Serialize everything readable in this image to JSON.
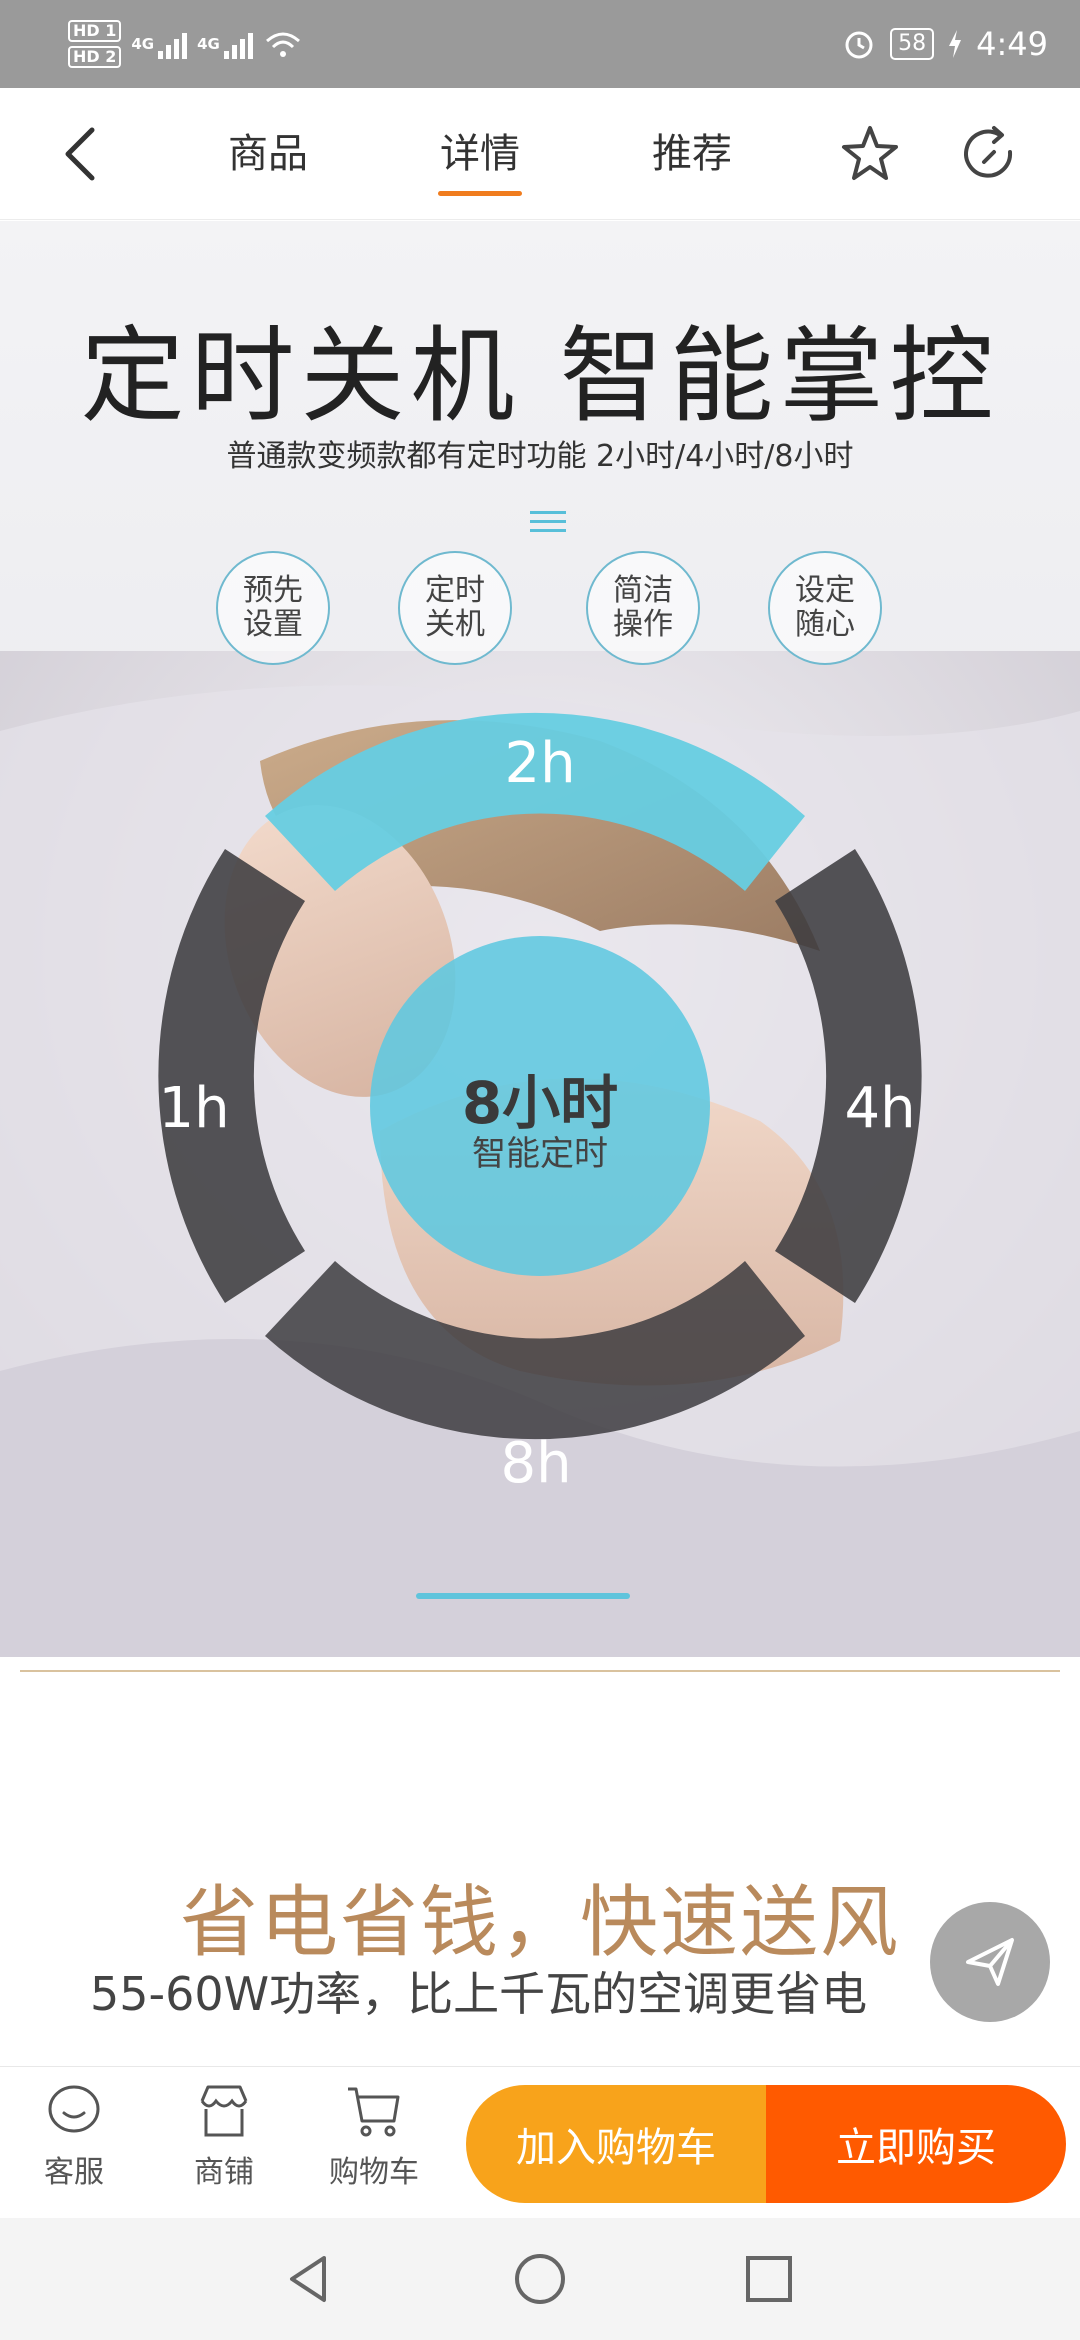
{
  "status_bar": {
    "hd1": "HD 1",
    "hd2": "HD 2",
    "network1": "4G",
    "network2": "4G",
    "battery": "58",
    "time": "4:49",
    "icons": [
      "wifi-icon",
      "alarm-icon",
      "charging-icon"
    ]
  },
  "nav": {
    "tabs": [
      {
        "label": "商品",
        "active": false
      },
      {
        "label": "详情",
        "active": true
      },
      {
        "label": "推荐",
        "active": false
      }
    ],
    "icons": [
      "back-icon",
      "star-icon",
      "refresh-icon"
    ],
    "accent_color": "#f07c1e"
  },
  "banner": {
    "title": "定时关机 智能掌控",
    "subtitle": "普通款变频款都有定时功能 2小时/4小时/8小时",
    "features": [
      {
        "line1": "预先",
        "line2": "设置"
      },
      {
        "line1": "定时",
        "line2": "关机"
      },
      {
        "line1": "简洁",
        "line2": "操作"
      },
      {
        "line1": "设定",
        "line2": "随心"
      }
    ],
    "timer_options": {
      "top": "2h",
      "left": "1h",
      "right": "4h",
      "bottom": "8h"
    },
    "selected": "2h",
    "center_main": "8小时",
    "center_sub": "智能定时",
    "highlight_color": "#66cde2",
    "ring_color": "#3d3c40"
  },
  "promo": {
    "title": "省电省钱，快速送风",
    "subtitle": "55-60W功率，比上千瓦的空调更省电",
    "title_color": "#b98a5c"
  },
  "bottom_bar": {
    "service": "客服",
    "shop": "商铺",
    "cart": "购物车",
    "add_to_cart": "加入购物车",
    "buy_now": "立即购买",
    "cart_color": "#f8a31b",
    "buy_color": "#ff5a00"
  },
  "system_nav": [
    "back-triangle-icon",
    "home-circle-icon",
    "recents-square-icon"
  ]
}
